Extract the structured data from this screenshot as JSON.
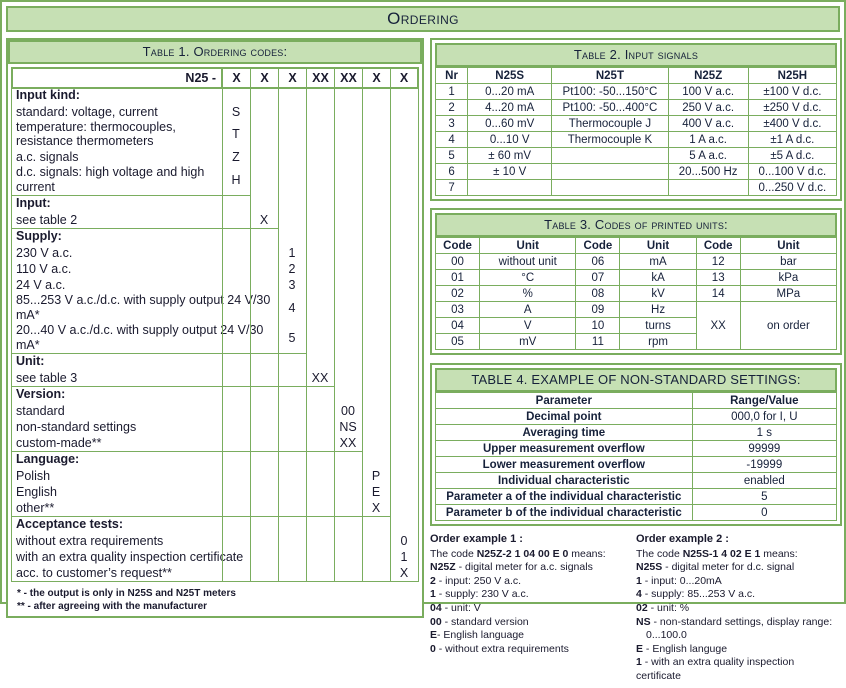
{
  "header": {
    "title": "Ordering"
  },
  "table1": {
    "heading": "Table 1. Ordering codes:",
    "code_prefix": "N25 -",
    "code_cells": [
      "X",
      "X",
      "X",
      "XX",
      "XX",
      "X",
      "X"
    ],
    "sections": [
      {
        "title": "Input kind:",
        "col": 0,
        "rows": [
          {
            "text": "standard: voltage, current",
            "code": "S"
          },
          {
            "text": "temperature: thermocouples, resistance thermometers",
            "code": "T",
            "two_line": true
          },
          {
            "text": "a.c. signals",
            "code": "Z"
          },
          {
            "text": "d.c. signals: high voltage and high current",
            "code": "H"
          }
        ]
      },
      {
        "title": "Input:",
        "col": 1,
        "rows": [
          {
            "text": "see table 2",
            "code": "X"
          }
        ]
      },
      {
        "title": "Supply:",
        "col": 2,
        "rows": [
          {
            "text": "230 V a.c.",
            "code": "1"
          },
          {
            "text": "110 V a.c.",
            "code": "2"
          },
          {
            "text": "24 V a.c.",
            "code": "3"
          },
          {
            "text": "85...253 V a.c./d.c. with supply output 24 V/30 mA*",
            "code": "4"
          },
          {
            "text": "20...40 V a.c./d.c. with supply output 24 V/30 mA*",
            "code": "5"
          }
        ]
      },
      {
        "title": "Unit:",
        "col": 3,
        "rows": [
          {
            "text": "see table 3",
            "code": "XX"
          }
        ]
      },
      {
        "title": "Version:",
        "col": 4,
        "rows": [
          {
            "text": "standard",
            "code": "00"
          },
          {
            "text": "non-standard settings",
            "code": "NS"
          },
          {
            "text": "custom-made**",
            "code": "XX"
          }
        ]
      },
      {
        "title": "Language:",
        "col": 5,
        "rows": [
          {
            "text": "Polish",
            "code": "P"
          },
          {
            "text": "English",
            "code": "E"
          },
          {
            "text": "other**",
            "code": "X"
          }
        ]
      },
      {
        "title": "Acceptance tests:",
        "col": 6,
        "rows": [
          {
            "text": "without extra requirements",
            "code": "0"
          },
          {
            "text": "with an extra quality inspection certificate",
            "code": "1"
          },
          {
            "text": "acc. to customer’s request**",
            "code": "X"
          }
        ]
      }
    ],
    "footnotes": [
      "* - the output is only in N25S and N25T meters",
      "** - after agreeing with the manufacturer"
    ]
  },
  "table2": {
    "heading": "Table 2. Input signals",
    "columns": [
      "Nr",
      "N25S",
      "N25T",
      "N25Z",
      "N25H"
    ],
    "rows": [
      [
        "1",
        "0...20 mA",
        "Pt100: -50...150°C",
        "100 V a.c.",
        "±100 V d.c."
      ],
      [
        "2",
        "4...20 mA",
        "Pt100: -50...400°C",
        "250 V a.c.",
        "±250 V d.c."
      ],
      [
        "3",
        "0...60 mV",
        "Thermocouple J",
        "400 V a.c.",
        "±400 V d.c."
      ],
      [
        "4",
        "0...10 V",
        "Thermocouple K",
        "1 A a.c.",
        "±1 A d.c."
      ],
      [
        "5",
        "± 60 mV",
        "",
        "5 A a.c.",
        "±5 A d.c."
      ],
      [
        "6",
        "± 10 V",
        "",
        "20...500 Hz",
        "0...100 V d.c."
      ],
      [
        "7",
        "",
        "",
        "",
        "0...250 V d.c."
      ]
    ]
  },
  "table3": {
    "heading": "Table 3. Codes of printed units:",
    "columns": [
      "Code",
      "Unit",
      "Code",
      "Unit",
      "Code",
      "Unit"
    ],
    "rows": [
      [
        "00",
        "without unit",
        "06",
        "mA",
        "12",
        "bar"
      ],
      [
        "01",
        "°C",
        "07",
        "kA",
        "13",
        "kPa"
      ],
      [
        "02",
        "%",
        "08",
        "kV",
        "14",
        "MPa"
      ],
      [
        "03",
        "A",
        "09",
        "Hz",
        "",
        ""
      ],
      [
        "04",
        "V",
        "10",
        "turns",
        "XX",
        "on order"
      ],
      [
        "05",
        "mV",
        "11",
        "rpm",
        "",
        ""
      ]
    ],
    "merged": {
      "code": "XX",
      "unit": "on order"
    }
  },
  "table4": {
    "heading": "TABLE 4. EXAMPLE OF NON-STANDARD SETTINGS:",
    "columns": [
      "Parameter",
      "Range/Value"
    ],
    "rows": [
      [
        "Decimal point",
        "000,0 for I, U"
      ],
      [
        "Averaging time",
        "1 s"
      ],
      [
        "Upper measurement overflow",
        "99999"
      ],
      [
        "Lower measurement overflow",
        "-19999"
      ],
      [
        "Individual characteristic",
        "enabled"
      ],
      [
        "Parameter a of the individual characteristic",
        "5"
      ],
      [
        "Parameter b of the individual characteristic",
        "0"
      ]
    ]
  },
  "examples": [
    {
      "title": "Order example 1 :",
      "lead_pre": "The code ",
      "lead_code": "N25Z-2 1 04 00 E 0",
      "lead_post": " means:",
      "lines": [
        {
          "code": "N25Z",
          "text": " - digital meter for a.c. signals"
        },
        {
          "code": "2",
          "text": " - input: 250 V a.c."
        },
        {
          "code": "1",
          "text": " - supply: 230 V a.c."
        },
        {
          "code": "04",
          "text": " - unit: V"
        },
        {
          "code": "00",
          "text": " - standard version"
        },
        {
          "code": "E",
          "text": "- English language"
        },
        {
          "code": "0",
          "text": " - without extra requirements"
        }
      ]
    },
    {
      "title": "Order example 2 :",
      "lead_pre": "The code ",
      "lead_code": "N25S-1 4 02 E 1",
      "lead_post": " means:",
      "lines": [
        {
          "code": "N25S",
          "text": " - digital meter for d.c. signal"
        },
        {
          "code": "1",
          "text": " - input: 0...20mA"
        },
        {
          "code": "4",
          "text": " - supply: 85...253 V a.c."
        },
        {
          "code": "02",
          "text": " - unit: %"
        },
        {
          "code": "NS",
          "text": " - non-standard settings, display range:"
        },
        {
          "code": "",
          "text": "0...100.0",
          "indent": true
        },
        {
          "code": "E",
          "text": " - English languge"
        },
        {
          "code": "1",
          "text": " - with an extra quality inspection certificate"
        }
      ]
    }
  ],
  "colors": {
    "border": "#7aad5e",
    "fill": "#c6e0b4",
    "text": "#16213a"
  }
}
